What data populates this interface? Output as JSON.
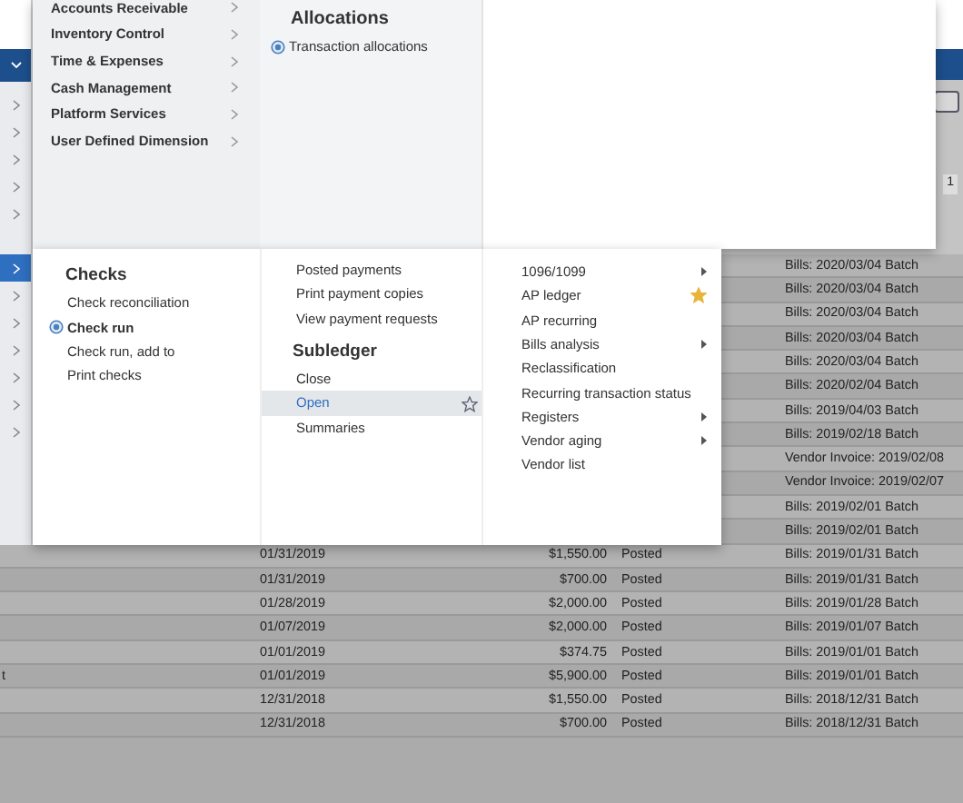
{
  "left_rail": {
    "items": [
      {
        "selected": false
      },
      {
        "selected": false
      },
      {
        "selected": false
      },
      {
        "selected": false
      },
      {
        "selected": false
      },
      {
        "selected": true
      },
      {
        "selected": false
      },
      {
        "selected": false
      },
      {
        "selected": false
      },
      {
        "selected": false
      },
      {
        "selected": false
      },
      {
        "selected": false
      }
    ]
  },
  "pagination": {
    "page": "1"
  },
  "menu": {
    "items": [
      {
        "label": "Accounts Receivable"
      },
      {
        "label": "Inventory Control"
      },
      {
        "label": "Time & Expenses"
      },
      {
        "label": "Cash Management"
      },
      {
        "label": "Platform Services"
      },
      {
        "label": "User Defined Dimension"
      }
    ]
  },
  "allocations": {
    "title": "Allocations",
    "items": [
      {
        "label": "Transaction allocations",
        "selected": true
      }
    ]
  },
  "checks": {
    "title": "Checks",
    "items": [
      {
        "label": "Check reconciliation",
        "selected": false
      },
      {
        "label": "Check run",
        "selected": true
      },
      {
        "label": "Check run, add to",
        "selected": false
      },
      {
        "label": "Print checks",
        "selected": false
      }
    ]
  },
  "payments": {
    "items": [
      {
        "label": "Posted payments"
      },
      {
        "label": "Print payment copies"
      },
      {
        "label": "View payment requests"
      }
    ]
  },
  "subledger": {
    "title": "Subledger",
    "items": [
      {
        "label": "Close",
        "highlighted": false,
        "starred": false
      },
      {
        "label": "Open",
        "highlighted": true,
        "starred": false
      },
      {
        "label": "Summaries",
        "highlighted": false,
        "starred": false
      }
    ]
  },
  "reports": {
    "items": [
      {
        "label": "1096/1099",
        "submenu": true,
        "starred": false
      },
      {
        "label": "AP ledger",
        "submenu": false,
        "starred": true
      },
      {
        "label": "AP recurring",
        "submenu": false,
        "starred": false
      },
      {
        "label": "Bills analysis",
        "submenu": true,
        "starred": false
      },
      {
        "label": "Reclassification",
        "submenu": false,
        "starred": false
      },
      {
        "label": "Recurring transaction status",
        "submenu": false,
        "starred": false
      },
      {
        "label": "Registers",
        "submenu": true,
        "starred": false
      },
      {
        "label": "Vendor aging",
        "submenu": true,
        "starred": false
      },
      {
        "label": "Vendor list",
        "submenu": false,
        "starred": false
      }
    ]
  },
  "table": {
    "rows": [
      {
        "description": "Bills: 2020/03/04 Batch"
      },
      {
        "description": "Bills: 2020/03/04 Batch"
      },
      {
        "description": "Bills: 2020/03/04 Batch"
      },
      {
        "description": "Bills: 2020/03/04 Batch"
      },
      {
        "description": "Bills: 2020/03/04 Batch"
      },
      {
        "description": "Bills: 2020/02/04 Batch"
      },
      {
        "description": "Bills: 2019/04/03 Batch"
      },
      {
        "description": "Bills: 2019/02/18 Batch"
      },
      {
        "description": "Vendor Invoice: 2019/02/08"
      },
      {
        "description": "Vendor Invoice: 2019/02/07"
      },
      {
        "description": "Bills: 2019/02/01 Batch"
      },
      {
        "description": "Bills: 2019/02/01 Batch"
      },
      {
        "date": "01/31/2019",
        "amount": "$1,550.00",
        "status": "Posted",
        "description": "Bills: 2019/01/31 Batch"
      },
      {
        "date": "01/31/2019",
        "amount": "$700.00",
        "status": "Posted",
        "description": "Bills: 2019/01/31 Batch"
      },
      {
        "date": "01/28/2019",
        "amount": "$2,000.00",
        "status": "Posted",
        "description": "Bills: 2019/01/28 Batch"
      },
      {
        "date": "01/07/2019",
        "amount": "$2,000.00",
        "status": "Posted",
        "description": "Bills: 2019/01/07 Batch"
      },
      {
        "date": "01/01/2019",
        "amount": "$374.75",
        "status": "Posted",
        "description": "Bills: 2019/01/01 Batch"
      },
      {
        "column_1": "t",
        "date": "01/01/2019",
        "amount": "$5,900.00",
        "status": "Posted",
        "description": "Bills: 2019/01/01 Batch"
      },
      {
        "date": "12/31/2018",
        "amount": "$1,550.00",
        "status": "Posted",
        "description": "Bills: 2018/12/31 Batch"
      },
      {
        "date": "12/31/2018",
        "amount": "$700.00",
        "status": "Posted",
        "description": "Bills: 2018/12/31 Batch"
      }
    ]
  }
}
